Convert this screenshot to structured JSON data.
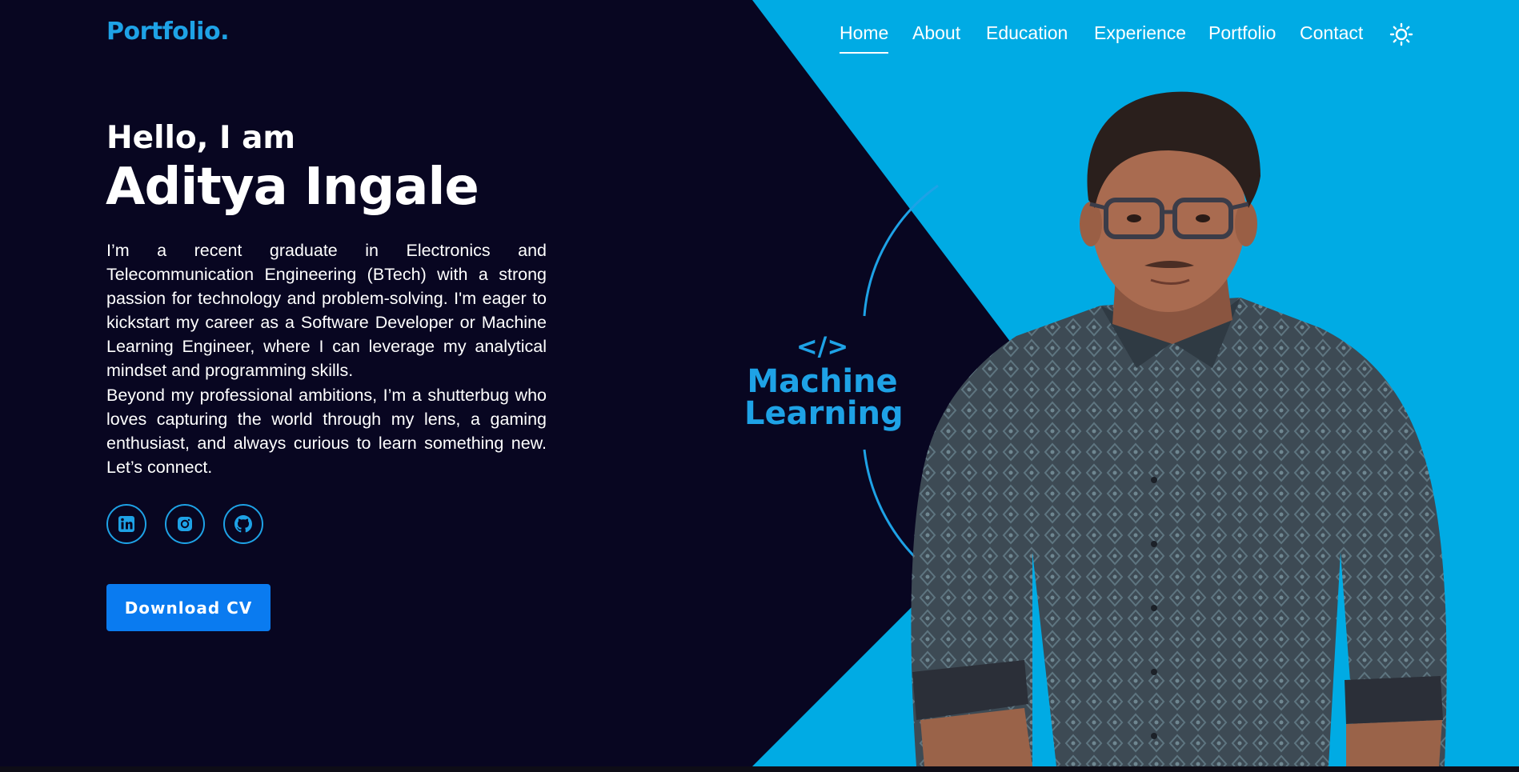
{
  "colors": {
    "background": "#080621",
    "accent": "#1ea2e6",
    "panel": "#00abe4",
    "button": "#0a7bf0",
    "text": "#ffffff"
  },
  "header": {
    "logo": "Portfolio.",
    "nav": [
      {
        "label": "Home",
        "active": true
      },
      {
        "label": "About"
      },
      {
        "label": "Education"
      },
      {
        "label": "Experience"
      },
      {
        "label": "Portfolio"
      },
      {
        "label": "Contact"
      }
    ],
    "theme_toggle_icon": "sun-icon"
  },
  "hero": {
    "greeting": "Hello, I am",
    "name": "Aditya Ingale",
    "bio": [
      "I’m a recent graduate in Electronics and Telecommunication Engineering (BTech) with a strong passion for technology and problem-solving. I'm eager to kickstart my career as a Software Developer or Machine Learning Engineer, where I can leverage my analytical mindset and programming skills.",
      "Beyond my professional ambitions, I’m a shutterbug who loves capturing the world through my lens, a gaming enthusiast, and always curious to learn something new. Let’s connect."
    ],
    "social": [
      {
        "icon": "linkedin-icon"
      },
      {
        "icon": "instagram-icon"
      },
      {
        "icon": "github-icon"
      }
    ],
    "cta": "Download CV"
  },
  "skill_badge": {
    "icon": "code-icon",
    "icon_text": "</>",
    "label_line1": "Machine",
    "label_line2": "Learning"
  },
  "portrait": {
    "icon": "profile-photo"
  }
}
